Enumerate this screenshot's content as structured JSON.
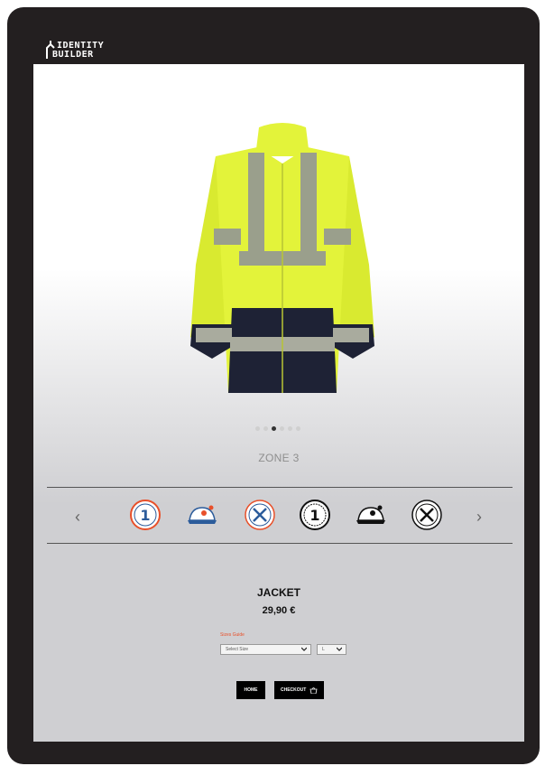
{
  "header": {
    "logo_line1": "IDENTITY",
    "logo_line2": "BUILDER"
  },
  "product": {
    "image_icon": "hi-vis-jacket-image",
    "zone_label": "ZONE 3",
    "title": "JACKET",
    "price": "29,90 €",
    "size_guide_label": "Sizes Guide",
    "size_select_value": "Select Size",
    "second_select_value": "L"
  },
  "carousel": {
    "slide_count": 6,
    "active_index": 2
  },
  "zones": {
    "prev_label": "‹",
    "next_label": "›",
    "icons": [
      "number-one-badge-icon",
      "helmet-color-icon",
      "tools-color-icon",
      "number-one-bw-icon",
      "helmet-bw-icon",
      "tools-bw-icon"
    ]
  },
  "buttons": {
    "home_label": "HOME",
    "checkout_label": "CHECKOUT"
  },
  "colors": {
    "frame": "#231f20",
    "accent": "#e8502a",
    "hivis_yellow": "#e3f33a",
    "navy": "#1e2235"
  }
}
